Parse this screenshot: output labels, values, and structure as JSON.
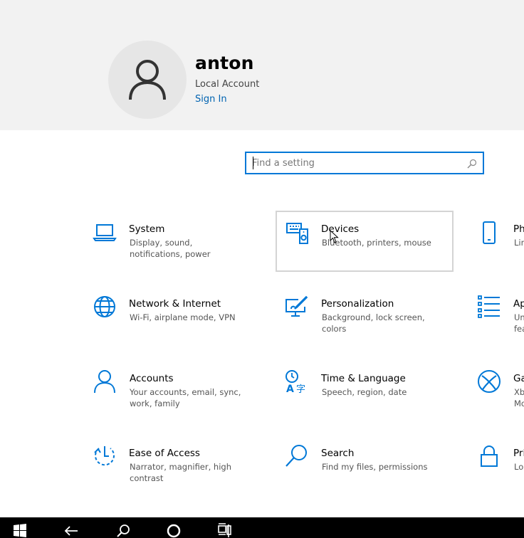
{
  "user": {
    "name": "anton",
    "account_type": "Local Account",
    "sign_in": "Sign In"
  },
  "search": {
    "placeholder": "Find a setting"
  },
  "tiles": [
    {
      "title": "System",
      "desc": "Display, sound, notifications, power",
      "icon": "laptop-icon"
    },
    {
      "title": "Devices",
      "desc": "Bluetooth, printers, mouse",
      "icon": "keyboard-speaker-icon"
    },
    {
      "title": "Ph",
      "desc": "Lin",
      "icon": "phone-icon"
    },
    {
      "title": "Network & Internet",
      "desc": "Wi-Fi, airplane mode, VPN",
      "icon": "globe-icon"
    },
    {
      "title": "Personalization",
      "desc": "Background, lock screen, colors",
      "icon": "paint-monitor-icon"
    },
    {
      "title": "Ap",
      "desc": "Un\nfea",
      "icon": "apps-list-icon"
    },
    {
      "title": "Accounts",
      "desc": "Your accounts, email, sync, work, family",
      "icon": "person-icon"
    },
    {
      "title": "Time & Language",
      "desc": "Speech, region, date",
      "icon": "time-language-icon"
    },
    {
      "title": "Ga",
      "desc": "Xb\nMo",
      "icon": "xbox-icon"
    },
    {
      "title": "Ease of Access",
      "desc": "Narrator, magnifier, high contrast",
      "icon": "ease-of-access-icon"
    },
    {
      "title": "Search",
      "desc": "Find my files, permissions",
      "icon": "search-icon"
    },
    {
      "title": "Pri",
      "desc": "Lo",
      "icon": "lock-icon"
    }
  ],
  "colors": {
    "accent": "#0078d7",
    "link": "#0063b1",
    "header_bg": "#f2f2f2",
    "taskbar": "#000000"
  },
  "taskbar": {
    "icons": [
      "windows-start-icon",
      "back-arrow-icon",
      "search-icon",
      "cortana-circle-icon",
      "task-view-icon"
    ]
  }
}
